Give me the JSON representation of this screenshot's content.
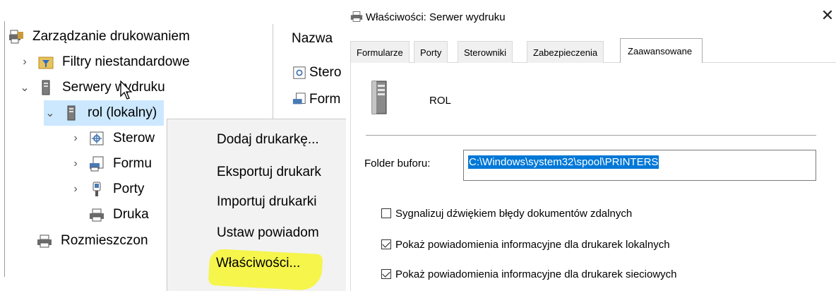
{
  "tree": {
    "root_label": "Zarządzanie drukowaniem",
    "items": [
      {
        "label": "Filtry niestandardowe",
        "chevron": ">"
      },
      {
        "label": "Serwery wydruku",
        "chevron": "v"
      },
      {
        "label": "rol (lokalny)",
        "chevron": "v"
      },
      {
        "label": "Sterow",
        "chevron": ">"
      },
      {
        "label": "Formu",
        "chevron": ">"
      },
      {
        "label": "Porty",
        "chevron": ">"
      },
      {
        "label": "Druka",
        "chevron": ""
      },
      {
        "label": "Rozmieszczon",
        "chevron": ""
      }
    ]
  },
  "list_pane": {
    "column_header": "Nazwa",
    "rows": [
      "Stero",
      "Form"
    ]
  },
  "context_menu": {
    "items": [
      "Dodaj drukarkę...",
      "Eksportuj drukark",
      "Importuj drukarki",
      "Ustaw powiadom",
      "Właściwości..."
    ],
    "highlighted_index": 4,
    "highlight_color": "#f5f53a"
  },
  "dialog": {
    "title": "Właściwości: Serwer wydruku",
    "close_label": "✕",
    "tabs": [
      "Formularze",
      "Porty",
      "Sterowniki",
      "Zabezpieczenia",
      "Zaawansowane"
    ],
    "active_tab": "Zaawansowane",
    "server_name": "ROL",
    "folder_label": "Folder buforu:",
    "folder_value": "C:\\Windows\\system32\\spool\\PRINTERS",
    "checkboxes": [
      {
        "label": "Sygnalizuj dźwiękiem błędy dokumentów zdalnych",
        "checked": false
      },
      {
        "label": "Pokaż powiadomienia informacyjne dla drukarek lokalnych",
        "checked": true
      },
      {
        "label": "Pokaż powiadomienia informacyjne dla drukarek sieciowych",
        "checked": true
      }
    ]
  },
  "colors": {
    "selection": "#cce8ff",
    "text_selection": "#0078d7"
  }
}
